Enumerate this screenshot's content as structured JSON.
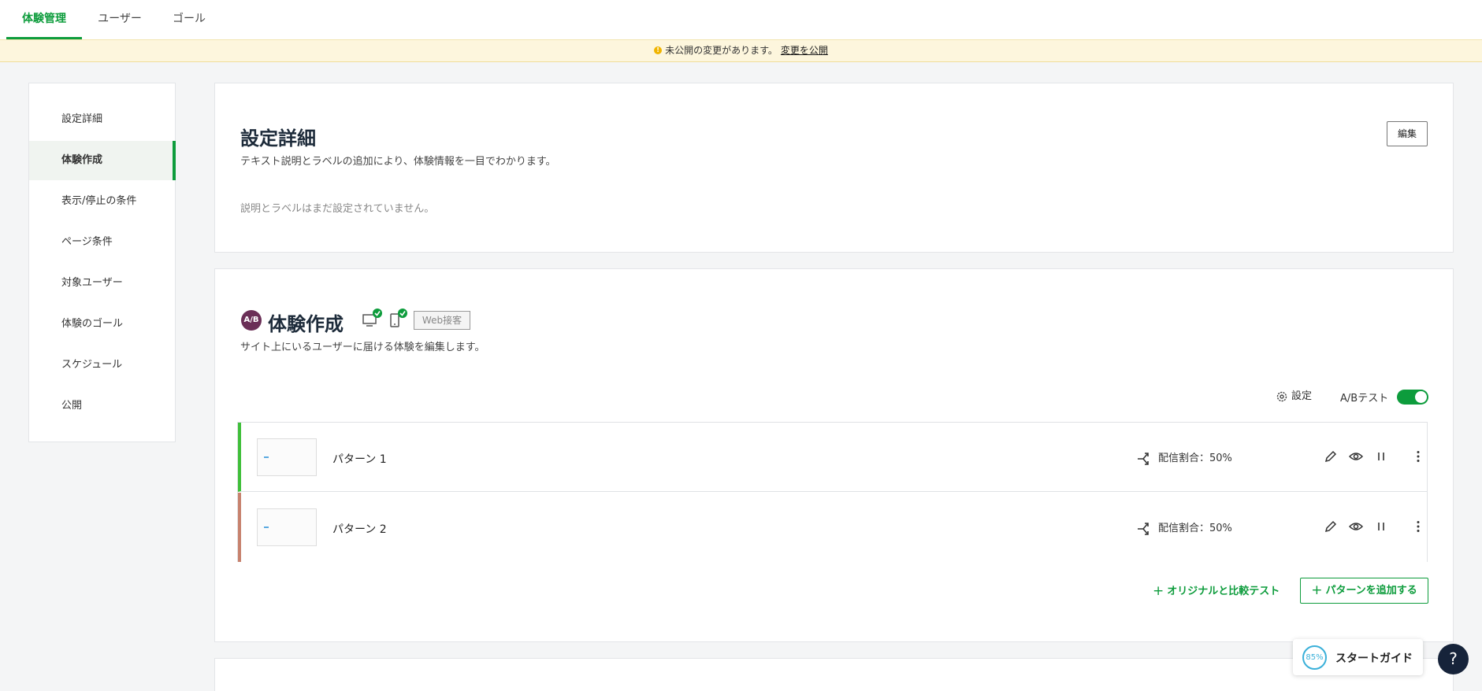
{
  "tabs": [
    {
      "label": "体験管理"
    },
    {
      "label": "ユーザー"
    },
    {
      "label": "ゴール"
    }
  ],
  "banner": {
    "message": "未公開の変更があります。",
    "link": "変更を公開"
  },
  "sidebar": {
    "items": [
      {
        "label": "設定詳細"
      },
      {
        "label": "体験作成"
      },
      {
        "label": "表示/停止の条件"
      },
      {
        "label": "ページ条件"
      },
      {
        "label": "対象ユーザー"
      },
      {
        "label": "体験のゴール"
      },
      {
        "label": "スケジュール"
      },
      {
        "label": "公開"
      }
    ]
  },
  "details": {
    "title": "設定詳細",
    "description": "テキスト説明とラベルの追加により、体験情報を一目でわかります。",
    "empty": "説明とラベルはまだ設定されていません。",
    "edit": "編集"
  },
  "experience": {
    "badge": "A/B",
    "title": "体験作成",
    "tag": "Web接客",
    "description": "サイト上にいるユーザーに届ける体験を編集します。",
    "settings": "設定",
    "ab_label": "A/Bテスト",
    "ab_enabled": true,
    "patterns": [
      {
        "name": "パターン 1",
        "distribution": "配信割合：50%",
        "color": "#3fbf3a"
      },
      {
        "name": "パターン 2",
        "distribution": "配信割合：50%",
        "color": "#c7826e"
      }
    ],
    "compare": "オリジナルと比較テスト",
    "add_pattern": "パターンを追加する"
  },
  "guide": {
    "progress": "85%",
    "label": "スタートガイド"
  },
  "help": "?",
  "colors": {
    "accent": "#0d9c3c",
    "badge": "#6b2f57",
    "help_bg": "#16233a"
  }
}
